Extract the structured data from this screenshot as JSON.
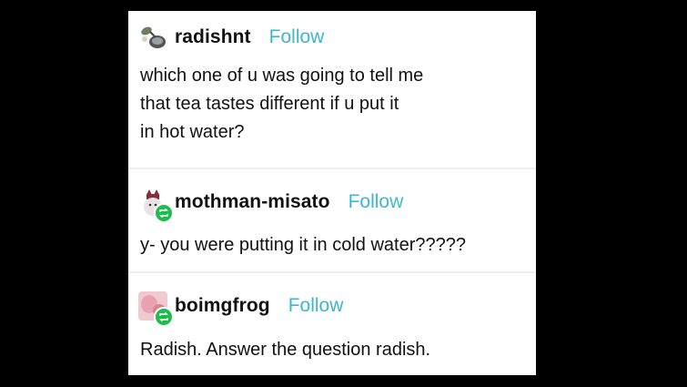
{
  "posts": [
    {
      "username": "radishnt",
      "follow_label": "Follow",
      "lines": [
        "which one of u was going to tell me",
        "that tea tastes different if u put it",
        "in hot water?"
      ]
    },
    {
      "username": "mothman-misato",
      "follow_label": "Follow",
      "lines": [
        "y- you were putting it in cold water?????"
      ]
    },
    {
      "username": "boimgfrog",
      "follow_label": "Follow",
      "lines": [
        "Radish. Answer the question radish."
      ]
    }
  ],
  "colors": {
    "follow": "#3fb6c9",
    "reblog_badge": "#1ebc4f",
    "background": "#000000",
    "card": "#ffffff"
  },
  "icons": [
    "bird-avatar-icon",
    "cat-avatar-icon",
    "pink-avatar-icon",
    "reblog-icon"
  ]
}
